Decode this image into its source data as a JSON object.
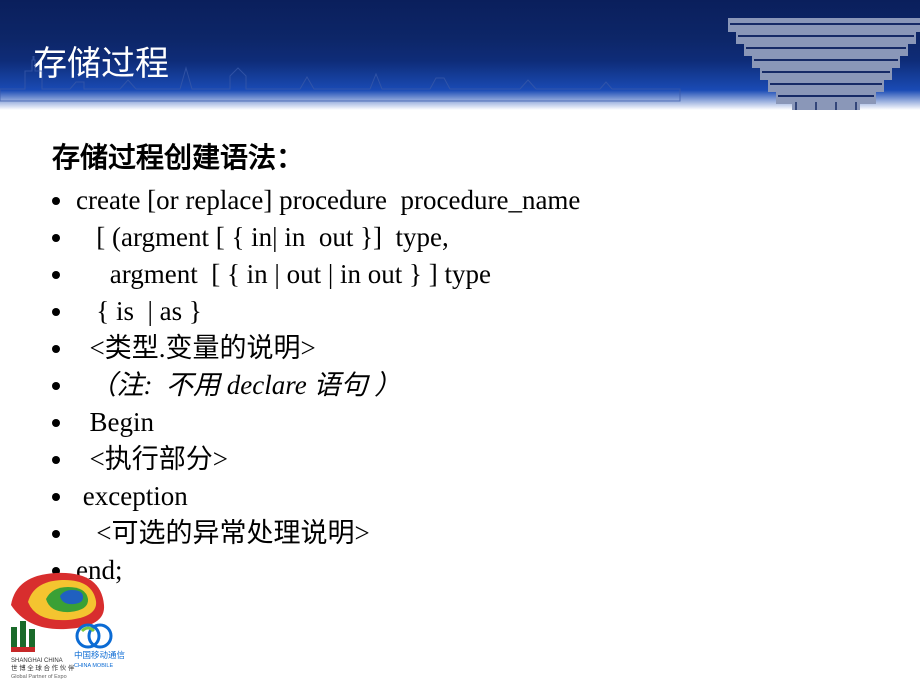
{
  "header": {
    "title": "存储过程"
  },
  "content": {
    "heading": "存储过程创建语法：",
    "lines": [
      {
        "text": "create [or replace] procedure  procedure_name",
        "italic": false
      },
      {
        "text": "   [ (argment [ { in| in  out }]  type,",
        "italic": false
      },
      {
        "text": "     argment  [ { in | out | in out } ] type",
        "italic": false
      },
      {
        "text": "   { is  | as }",
        "italic": false
      },
      {
        "text": "  <类型.变量的说明>",
        "italic": false
      },
      {
        "text": "  （注:  不用 declare 语句 ）",
        "italic": true
      },
      {
        "text": "  Begin",
        "italic": false
      },
      {
        "text": "  <执行部分>",
        "italic": false
      },
      {
        "text": " exception",
        "italic": false
      },
      {
        "text": "   <可选的异常处理说明>",
        "italic": false
      },
      {
        "text": "end;",
        "italic": false
      }
    ]
  }
}
